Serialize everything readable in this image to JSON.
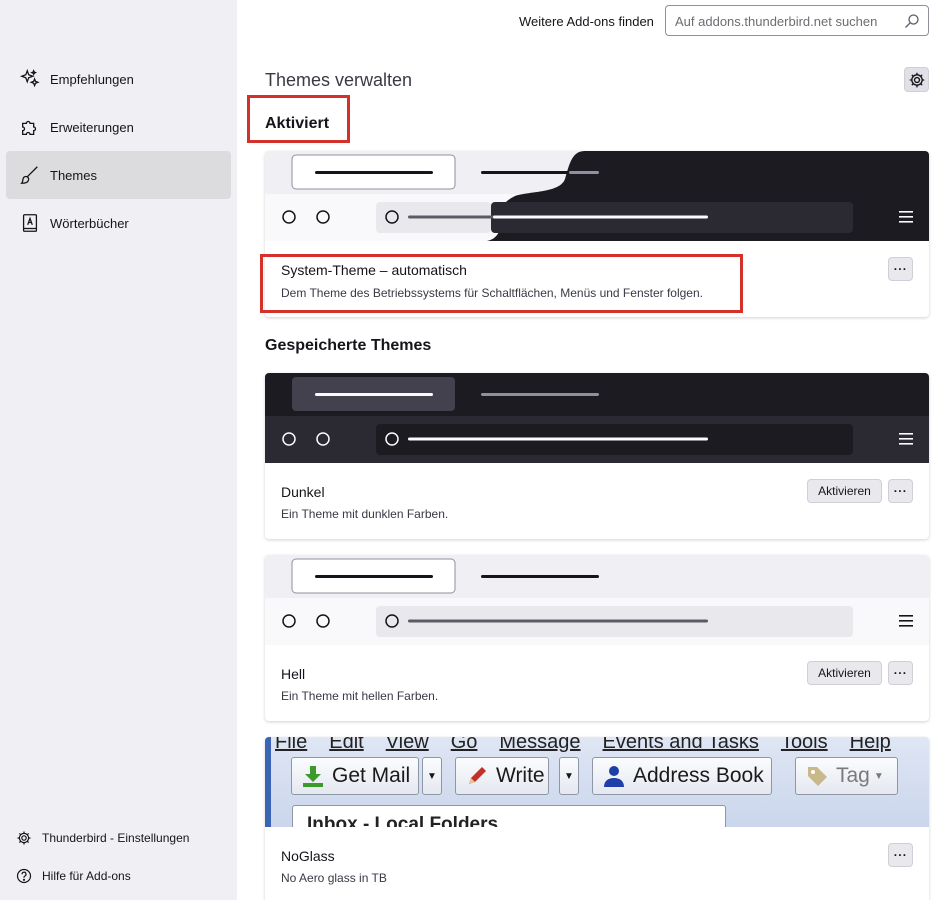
{
  "sidebar": {
    "categories": [
      {
        "label": "Empfehlungen",
        "icon": "sparkle-icon"
      },
      {
        "label": "Erweiterungen",
        "icon": "puzzle-icon"
      },
      {
        "label": "Themes",
        "icon": "brush-icon",
        "selected": true
      },
      {
        "label": "Wörterbücher",
        "icon": "dictionary-icon"
      }
    ],
    "footer": {
      "settings_label": "Thunderbird - Einstellungen",
      "help_label": "Hilfe für Add-ons"
    }
  },
  "header": {
    "find_label": "Weitere Add-ons finden",
    "search_placeholder": "Auf addons.thunderbird.net suchen"
  },
  "main": {
    "title": "Themes verwalten",
    "active_heading": "Aktiviert",
    "saved_heading": "Gespeicherte Themes"
  },
  "themes": {
    "active": {
      "name": "System-Theme – automatisch",
      "description": "Dem Theme des Betriebssystems für Schaltflächen, Menüs und Fenster folgen.",
      "more_label": "···"
    },
    "saved": [
      {
        "name": "Dunkel",
        "description": "Ein Theme mit dunklen Farben.",
        "activate_label": "Aktivieren",
        "more_label": "···"
      },
      {
        "name": "Hell",
        "description": "Ein Theme mit hellen Farben.",
        "activate_label": "Aktivieren",
        "more_label": "···"
      },
      {
        "name": "NoGlass",
        "description": "No Aero glass in TB",
        "more_label": "···"
      }
    ]
  },
  "noglass_preview": {
    "menu": [
      "File",
      "Edit",
      "View",
      "Go",
      "Message",
      "Events and Tasks",
      "Tools",
      "Help"
    ],
    "get_mail": "Get Mail",
    "write": "Write",
    "address_book": "Address Book",
    "tag": "Tag",
    "inbox": "Inbox - Local Folders"
  },
  "colors": {
    "highlight_box": "#d3312a",
    "sidebar_bg": "#f0f0f4",
    "dark_theme": "#1c1b22",
    "light_theme": "#f0f0f4"
  }
}
